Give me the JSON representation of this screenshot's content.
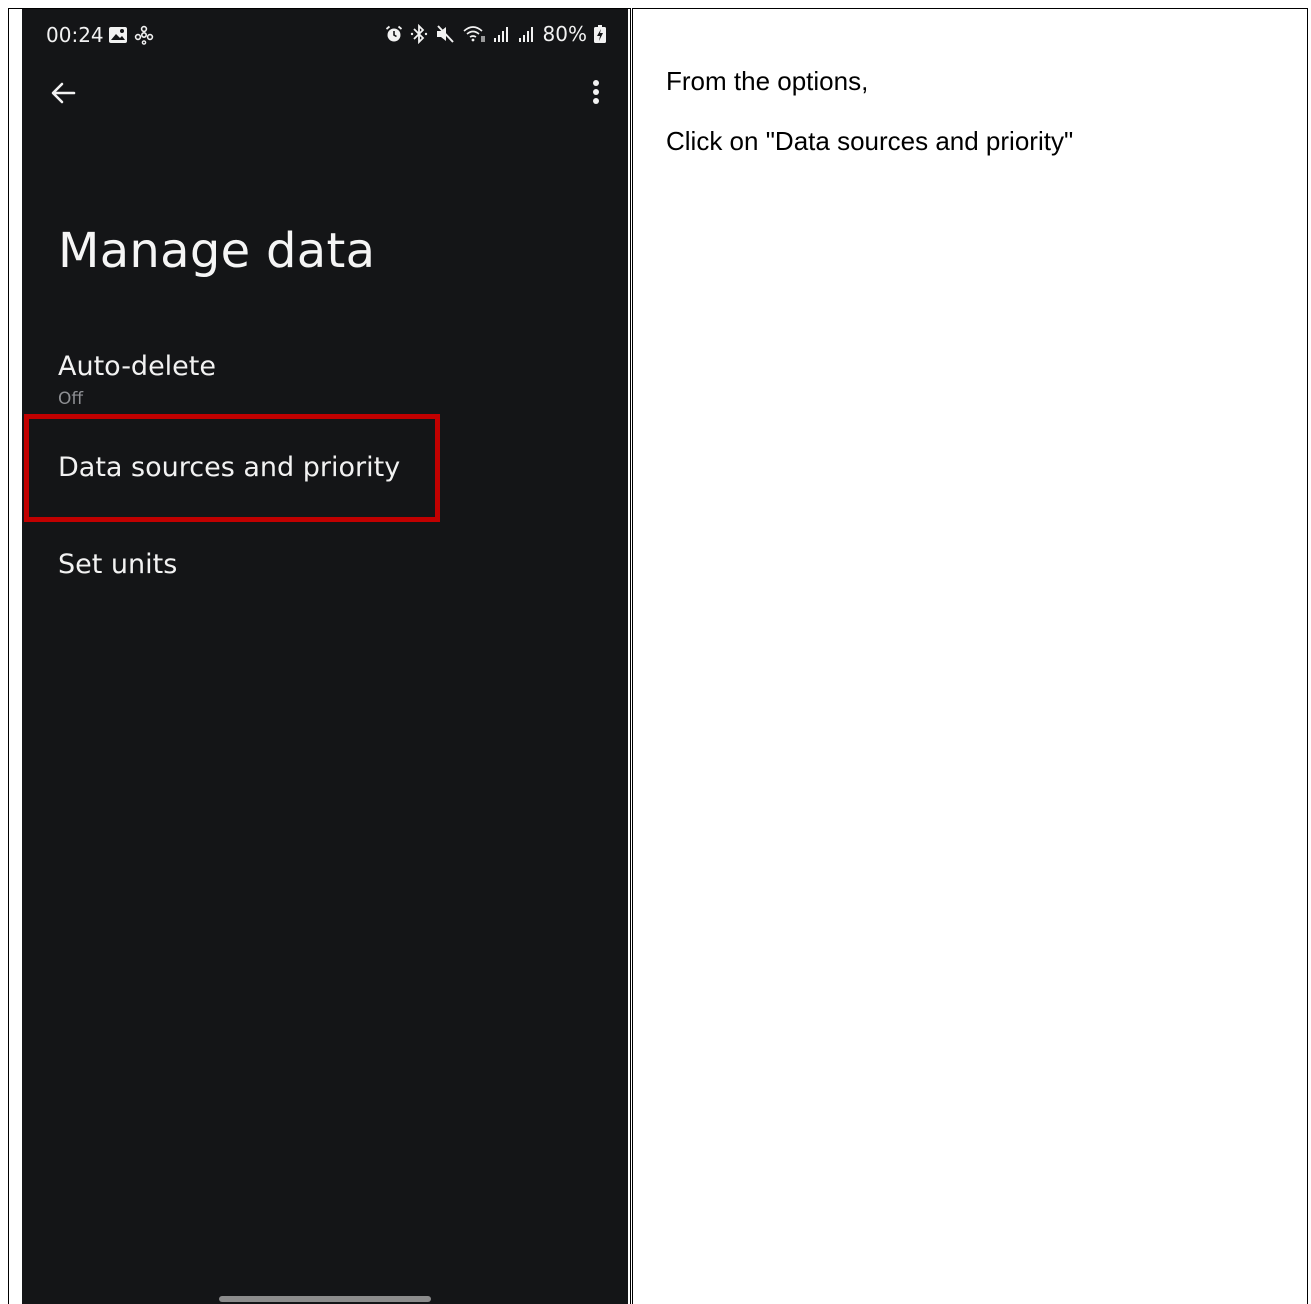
{
  "status_bar": {
    "time": "00:24",
    "battery": "80%",
    "left_icons": [
      "gallery-icon",
      "fan-icon"
    ],
    "right_icons": [
      "alarm-icon",
      "bluetooth-icon",
      "mute-icon",
      "wifi-icon",
      "signal-icon",
      "signal-icon",
      "battery-charging-icon"
    ]
  },
  "toolbar": {
    "back_icon": "arrow-left-icon",
    "more_icon": "more-vertical-icon"
  },
  "page": {
    "title": "Manage data"
  },
  "menu": {
    "items": [
      {
        "label": "Auto-delete",
        "sublabel": "Off"
      },
      {
        "label": "Data sources and priority"
      },
      {
        "label": "Set units"
      }
    ],
    "highlighted_index": 1,
    "highlight_color": "#c10000"
  },
  "instructions": {
    "line1": "From the options,",
    "line2": "Click on \"Data sources and priority\""
  },
  "colors": {
    "phone_background": "#141517",
    "text_primary": "#f2f2f2",
    "text_secondary": "#8e8f93"
  }
}
